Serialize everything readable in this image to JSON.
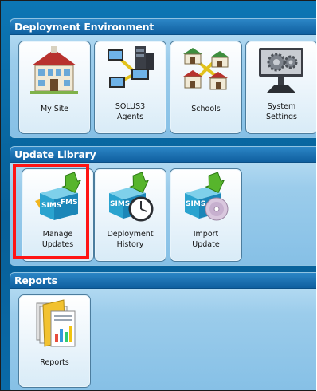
{
  "sections": [
    {
      "title": "Deployment Environment",
      "tiles": [
        {
          "label": "My Site",
          "icon": "school-house-icon"
        },
        {
          "label": "SOLUS3\nAgents",
          "icon": "network-agents-icon"
        },
        {
          "label": "Schools",
          "icon": "schools-network-icon"
        },
        {
          "label": "System\nSettings",
          "icon": "gears-monitor-icon"
        }
      ]
    },
    {
      "title": "Update Library",
      "tiles": [
        {
          "label": "Manage\nUpdates",
          "icon": "sims-fms-update-icon",
          "badge": [
            "SIMS",
            "FMS"
          ]
        },
        {
          "label": "Deployment\nHistory",
          "icon": "deployment-history-icon",
          "badge": [
            "SIMS"
          ]
        },
        {
          "label": "Import\nUpdate",
          "icon": "import-update-icon",
          "badge": [
            "SIMS"
          ]
        }
      ]
    },
    {
      "title": "Reports",
      "tiles": [
        {
          "label": "Reports",
          "icon": "reports-icon"
        }
      ]
    }
  ],
  "highlight": {
    "target": "Manage Updates",
    "color": "#ff1414"
  }
}
